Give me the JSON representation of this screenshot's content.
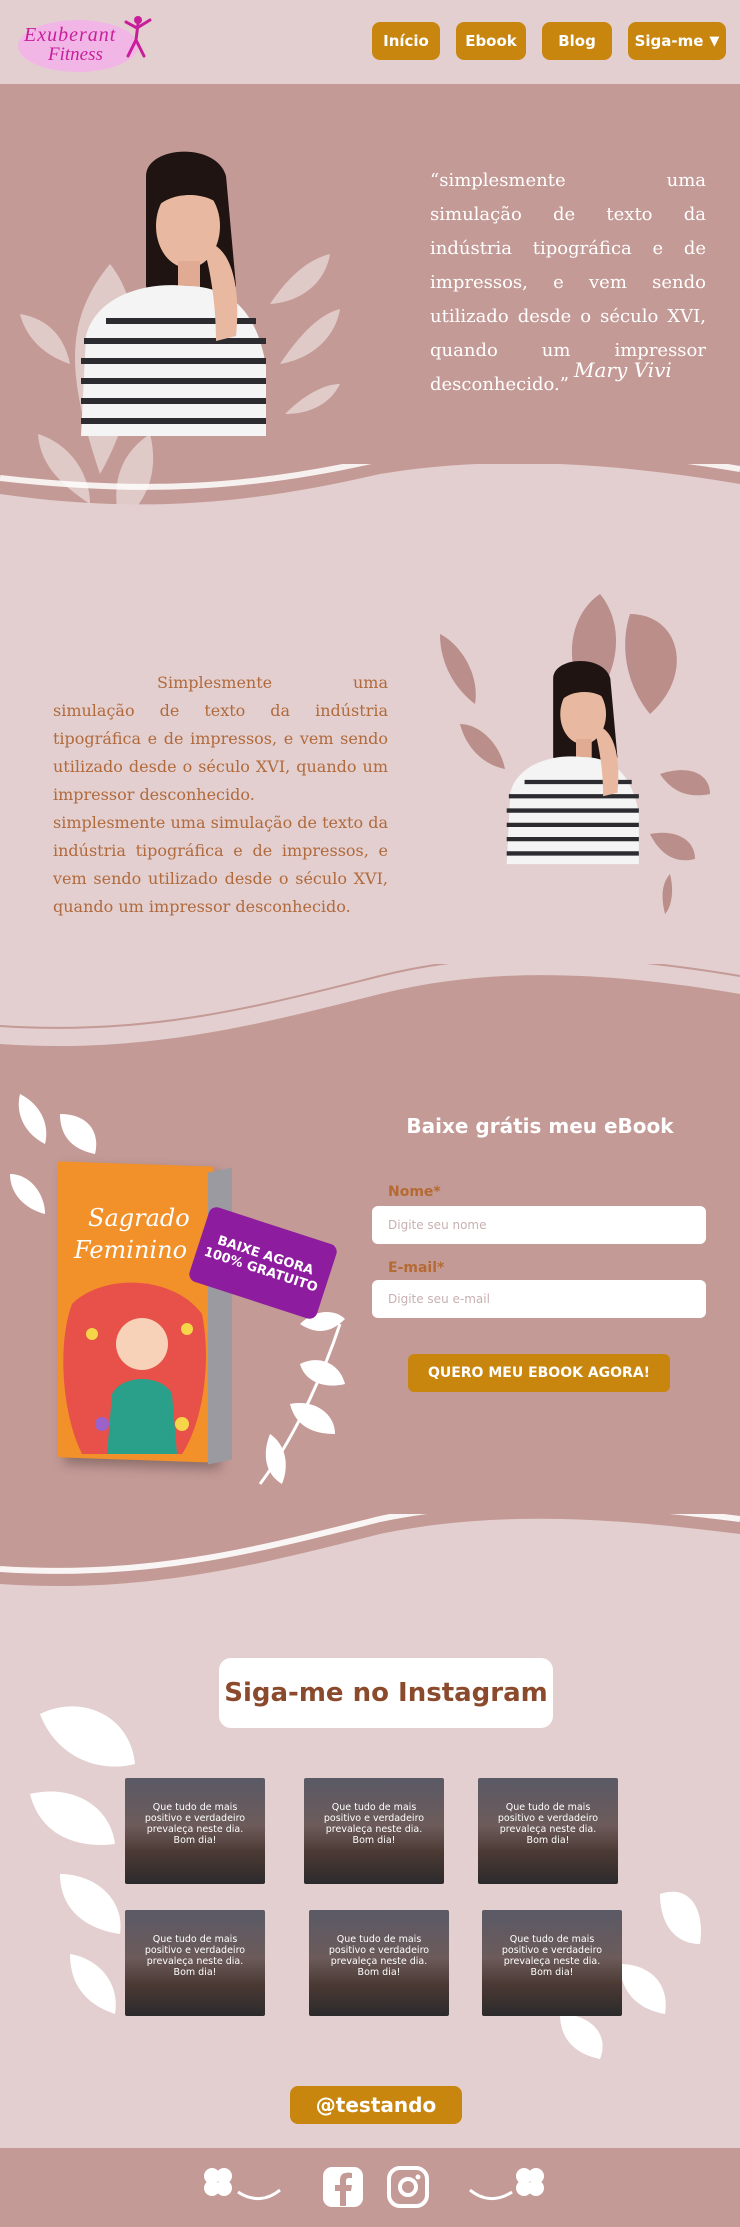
{
  "brand": {
    "logo_line1": "Exuberant",
    "logo_line2": "Fitness"
  },
  "nav": {
    "items": [
      {
        "label": "Início"
      },
      {
        "label": "Ebook"
      },
      {
        "label": "Blog"
      },
      {
        "label": "Siga-me"
      }
    ],
    "dropdown_icon": "chevron-down-icon"
  },
  "hero": {
    "quote": "“simplesmente uma simulação de texto da indústria tipográfica e de impressos, e vem sendo utilizado desde o século XVI, quando um impressor desconhecido.”",
    "signature": "Mary Vivi"
  },
  "about": {
    "paragraph1": "Simplesmente uma simulação de texto da indústria tipográfica e de impressos, e vem sendo utilizado desde o século XVI, quando um impressor desconhecido.",
    "paragraph2": "simplesmente uma simulação de texto da indústria tipográfica e de impressos, e vem sendo utilizado desde o século XVI, quando um impressor desconhecido."
  },
  "ebook": {
    "title": "Baixe grátis meu eBook",
    "book_title_line1": "Sagrado",
    "book_title_line2": "Feminino",
    "badge_line1": "BAIXE AGORA",
    "badge_line2": "100% GRATUITO",
    "name_label": "Nome*",
    "name_placeholder": "Digite seu nome",
    "email_label": "E-mail*",
    "email_placeholder": "Digite seu e-mail",
    "submit_label": "QUERO MEU EBOOK AGORA!"
  },
  "instagram": {
    "title": "Siga-me no Instagram",
    "post_text_lines": [
      "Que tudo de mais",
      "positivo e verdadeiro",
      "prevaleça neste dia.",
      "Bom dia!"
    ],
    "handle": "@testando"
  },
  "colors": {
    "page_bg": "#e3cfcf",
    "section_bg": "#c49a96",
    "accent": "#c9860f",
    "text_brown": "#b06a3c",
    "title_brown": "#8c4a2c",
    "badge_purple": "#8e1c9e"
  },
  "footer": {
    "icons": [
      "clover-icon",
      "facebook-icon",
      "instagram-icon",
      "clover-icon"
    ]
  }
}
